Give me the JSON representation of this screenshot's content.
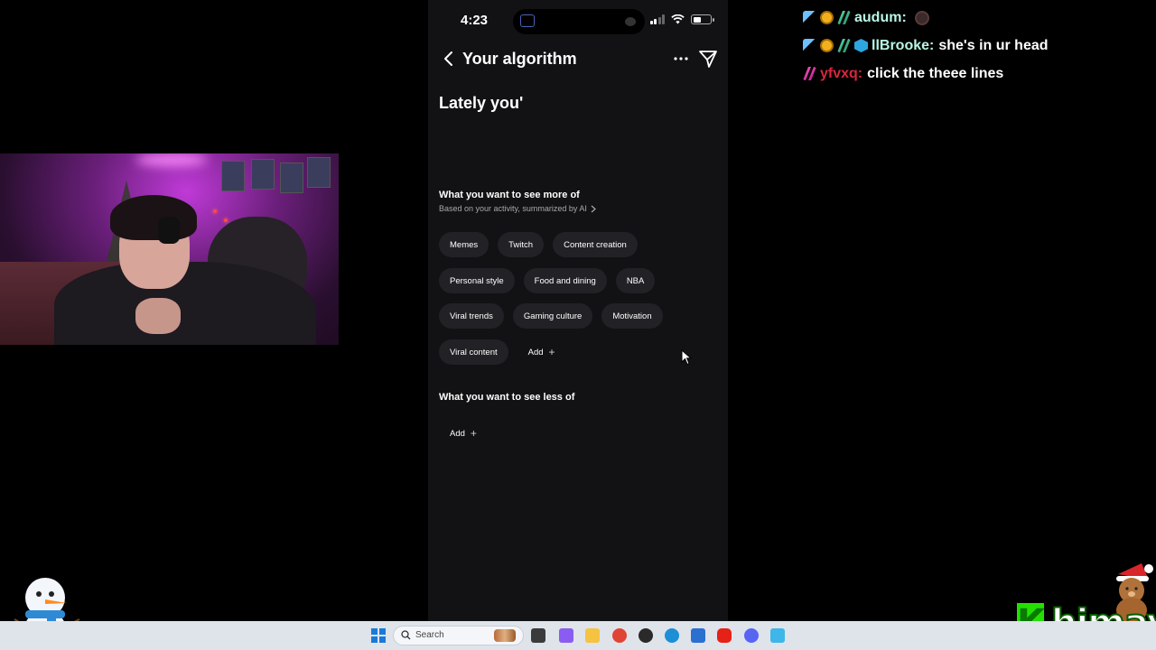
{
  "phone": {
    "status": {
      "time": "4:23"
    },
    "nav": {
      "title": "Your algorithm"
    },
    "lately": "Lately you'",
    "more_section": {
      "title": "What you want to see more of",
      "subtitle": "Based on your activity, summarized by AI",
      "rows": [
        [
          "Memes",
          "Twitch",
          "Content creation"
        ],
        [
          "Personal style",
          "Food and dining",
          "NBA"
        ],
        [
          "Viral trends",
          "Gaming culture",
          "Motivation"
        ],
        [
          "Viral content"
        ]
      ],
      "add_label": "Add"
    },
    "less_section": {
      "title": "What you want to see less of",
      "add_label": "Add"
    }
  },
  "chat": {
    "messages": [
      {
        "user": "audum:",
        "text": "",
        "user_color": "#b9f5e6",
        "badges": [
          "sword",
          "coin",
          "slash"
        ],
        "emote": true
      },
      {
        "user": "llBrooke:",
        "text": "she's in ur head",
        "user_color": "#b9f5e6",
        "badges": [
          "sword",
          "coin",
          "slash",
          "cube"
        ],
        "emote": false
      },
      {
        "user": "yfvxq:",
        "text": "click the theee lines",
        "user_color": "#d7263d",
        "badges": [
          "slash-pink"
        ],
        "emote": false
      }
    ]
  },
  "taskbar": {
    "search_label": "Search",
    "apps": [
      {
        "icon": "task-view-icon",
        "color": "#3b3b3b"
      },
      {
        "icon": "copilot-icon",
        "color": "#8a5cf0"
      },
      {
        "icon": "file-explorer-icon",
        "color": "#f5c242"
      },
      {
        "icon": "chrome-icon",
        "color": "#e04434"
      },
      {
        "icon": "obs-icon",
        "color": "#2a2a2a"
      },
      {
        "icon": "edge-icon",
        "color": "#1c8fd6"
      },
      {
        "icon": "store-icon",
        "color": "#2b6fd1"
      },
      {
        "icon": "youtube-icon",
        "color": "#e62117"
      },
      {
        "icon": "discord-icon",
        "color": "#5865f2"
      },
      {
        "icon": "app-icon",
        "color": "#3fb6e8"
      }
    ]
  },
  "logo": {
    "letter": "K",
    "text": "himay"
  }
}
